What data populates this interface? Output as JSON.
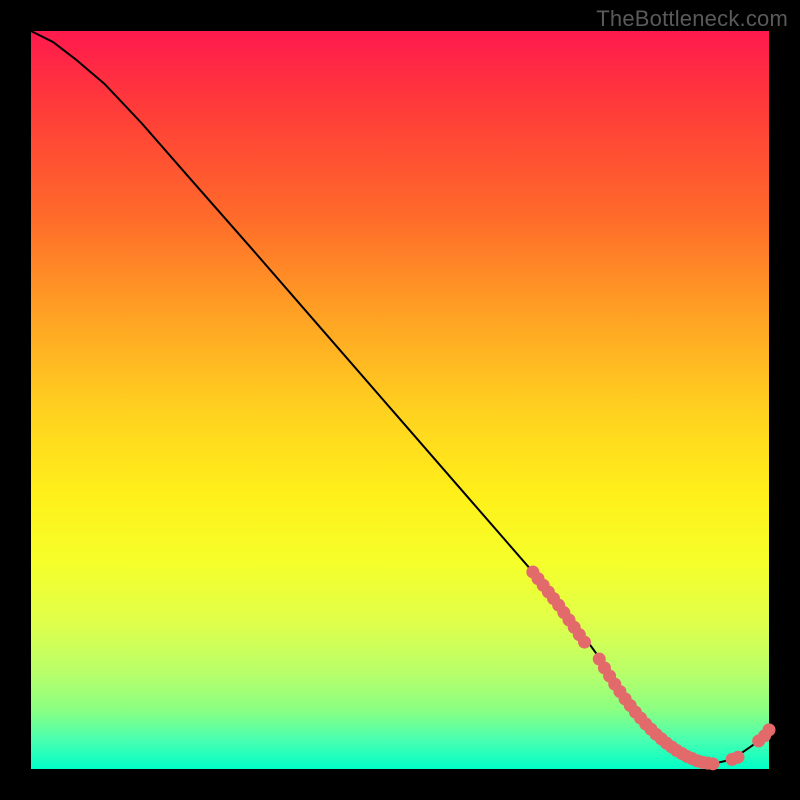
{
  "watermark": "TheBottleneck.com",
  "colors": {
    "frame": "#000000",
    "curve": "#000000",
    "marker": "#e26a6a",
    "gradient_top": "#ff1a4d",
    "gradient_bottom": "#00ffc8"
  },
  "chart_data": {
    "type": "line",
    "title": "",
    "xlabel": "",
    "ylabel": "",
    "xlim": [
      0,
      100
    ],
    "ylim": [
      0,
      100
    ],
    "curve": {
      "x": [
        0,
        3,
        6,
        10,
        15,
        22,
        30,
        40,
        50,
        60,
        68,
        73,
        77,
        80,
        83,
        86,
        89,
        92,
        95,
        98.5,
        100
      ],
      "y": [
        100,
        98.5,
        96.2,
        92.8,
        87.5,
        79.5,
        70.4,
        58.9,
        47.4,
        35.9,
        26.7,
        20.6,
        15.1,
        10.4,
        6.4,
        3.4,
        1.5,
        0.6,
        1.3,
        3.7,
        5.3
      ]
    },
    "markers_dense": {
      "x": [
        68.0,
        68.7,
        69.4,
        70.1,
        70.8,
        71.5,
        72.2,
        72.9,
        73.6,
        74.3,
        75.0,
        77.0,
        77.7,
        78.4,
        79.1,
        79.8,
        80.5,
        81.2,
        81.9,
        82.6,
        83.3,
        84.0,
        84.7,
        85.4,
        86.1,
        86.8,
        87.5,
        88.2,
        88.9,
        89.6,
        90.3,
        91.0,
        91.7,
        92.4
      ],
      "y": [
        26.7,
        25.8,
        24.9,
        24.0,
        23.1,
        22.2,
        21.2,
        20.2,
        19.2,
        18.2,
        17.2,
        14.9,
        13.7,
        12.6,
        11.5,
        10.5,
        9.5,
        8.6,
        7.7,
        6.9,
        6.1,
        5.4,
        4.7,
        4.1,
        3.5,
        3.0,
        2.5,
        2.1,
        1.7,
        1.4,
        1.1,
        0.9,
        0.8,
        0.7
      ]
    },
    "markers_sparse": {
      "x": [
        95.0,
        95.8,
        98.6,
        99.4,
        100.0
      ],
      "y": [
        1.3,
        1.6,
        3.8,
        4.5,
        5.3
      ]
    }
  }
}
